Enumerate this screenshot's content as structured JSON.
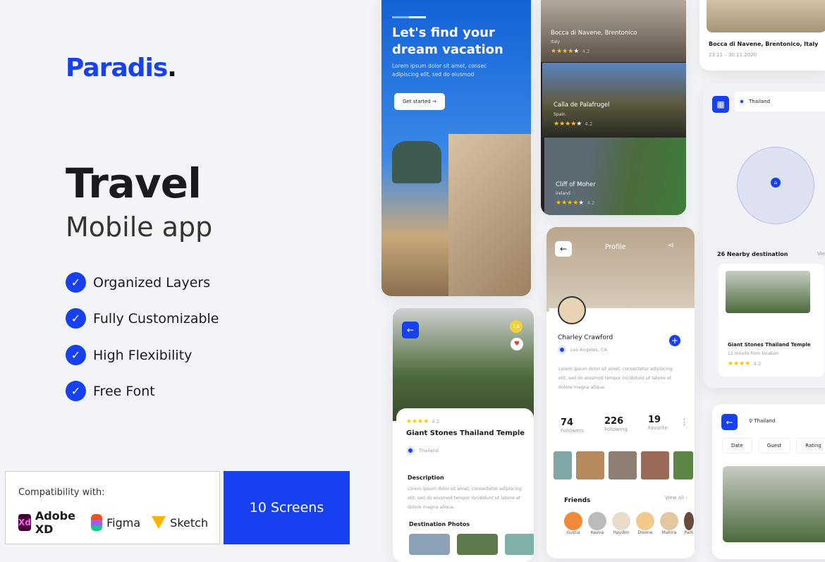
{
  "brand": {
    "name": "Paradis",
    "dot": "."
  },
  "headline": {
    "title": "Travel",
    "subtitle": "Mobile app"
  },
  "features": [
    "Organized Layers",
    "Fully Customizable",
    "High Flexibility",
    "Free Font"
  ],
  "compatibility": {
    "label": "Compatibility with:",
    "tools": [
      "Adobe XD",
      "Figma",
      "Sketch"
    ],
    "xd_icon": "Xd"
  },
  "screens_badge": "10 Screens",
  "colors": {
    "accent": "#1640f0",
    "background": "#f3f4f7"
  },
  "onboarding": {
    "title": "Let's find your dream vacation",
    "text": "Lorem ipsum dolor sit amet, consec adipiscing elit, sed do eiusmod",
    "button": "Get started →"
  },
  "destinations": [
    {
      "name": "Bocca di Navene, Brentonico",
      "country": "Italy",
      "rating": "4.2"
    },
    {
      "name": "Calla de Palafrugel",
      "country": "Spain",
      "rating": "4.2"
    },
    {
      "name": "Cliff of Moher",
      "country": "Ireland",
      "rating": "4.2"
    }
  ],
  "trip": {
    "name": "Bocca di Navene, Brentonico, Italy",
    "dates": "23.11 – 30.11.2020"
  },
  "detail": {
    "score": "7,8",
    "rating": "4.2",
    "title": "Giant Stones Thailand Temple",
    "location": "Thailand",
    "desc_title": "Description",
    "desc": "Lorem ipsum dolor sit amet, consectetur adipiscing elit, sed do eiusmod tempor incididunt ut labore et dolore magna aliqua.",
    "photos_title": "Destination Photos"
  },
  "profile": {
    "title": "Profile",
    "name": "Charley Crawford",
    "location": "Los Angeles, CA",
    "bio": "Lorem ipsum dolor sit amet, consectetur adipiscing elit, sed do eiusmod tempor incididunt ut labore et dolore magna aliqua.",
    "stats": [
      {
        "value": "74",
        "label": "Followers"
      },
      {
        "value": "226",
        "label": "Following"
      },
      {
        "value": "19",
        "label": "Favorite"
      }
    ],
    "friends_title": "Friends",
    "view_all": "View all ›",
    "friends": [
      "Gustia",
      "Keeva",
      "Haydon",
      "Dionne",
      "Mahira",
      "Park"
    ]
  },
  "map": {
    "search": "Thailand",
    "nearby": "26 Nearby destination",
    "view": "View",
    "card": {
      "title": "Giant Stones Thailand Temple",
      "sub": "12 minute from location",
      "rating": "4.2"
    }
  },
  "search": {
    "query": "Thailand",
    "filters": [
      "Date",
      "Guest",
      "Rating"
    ]
  }
}
